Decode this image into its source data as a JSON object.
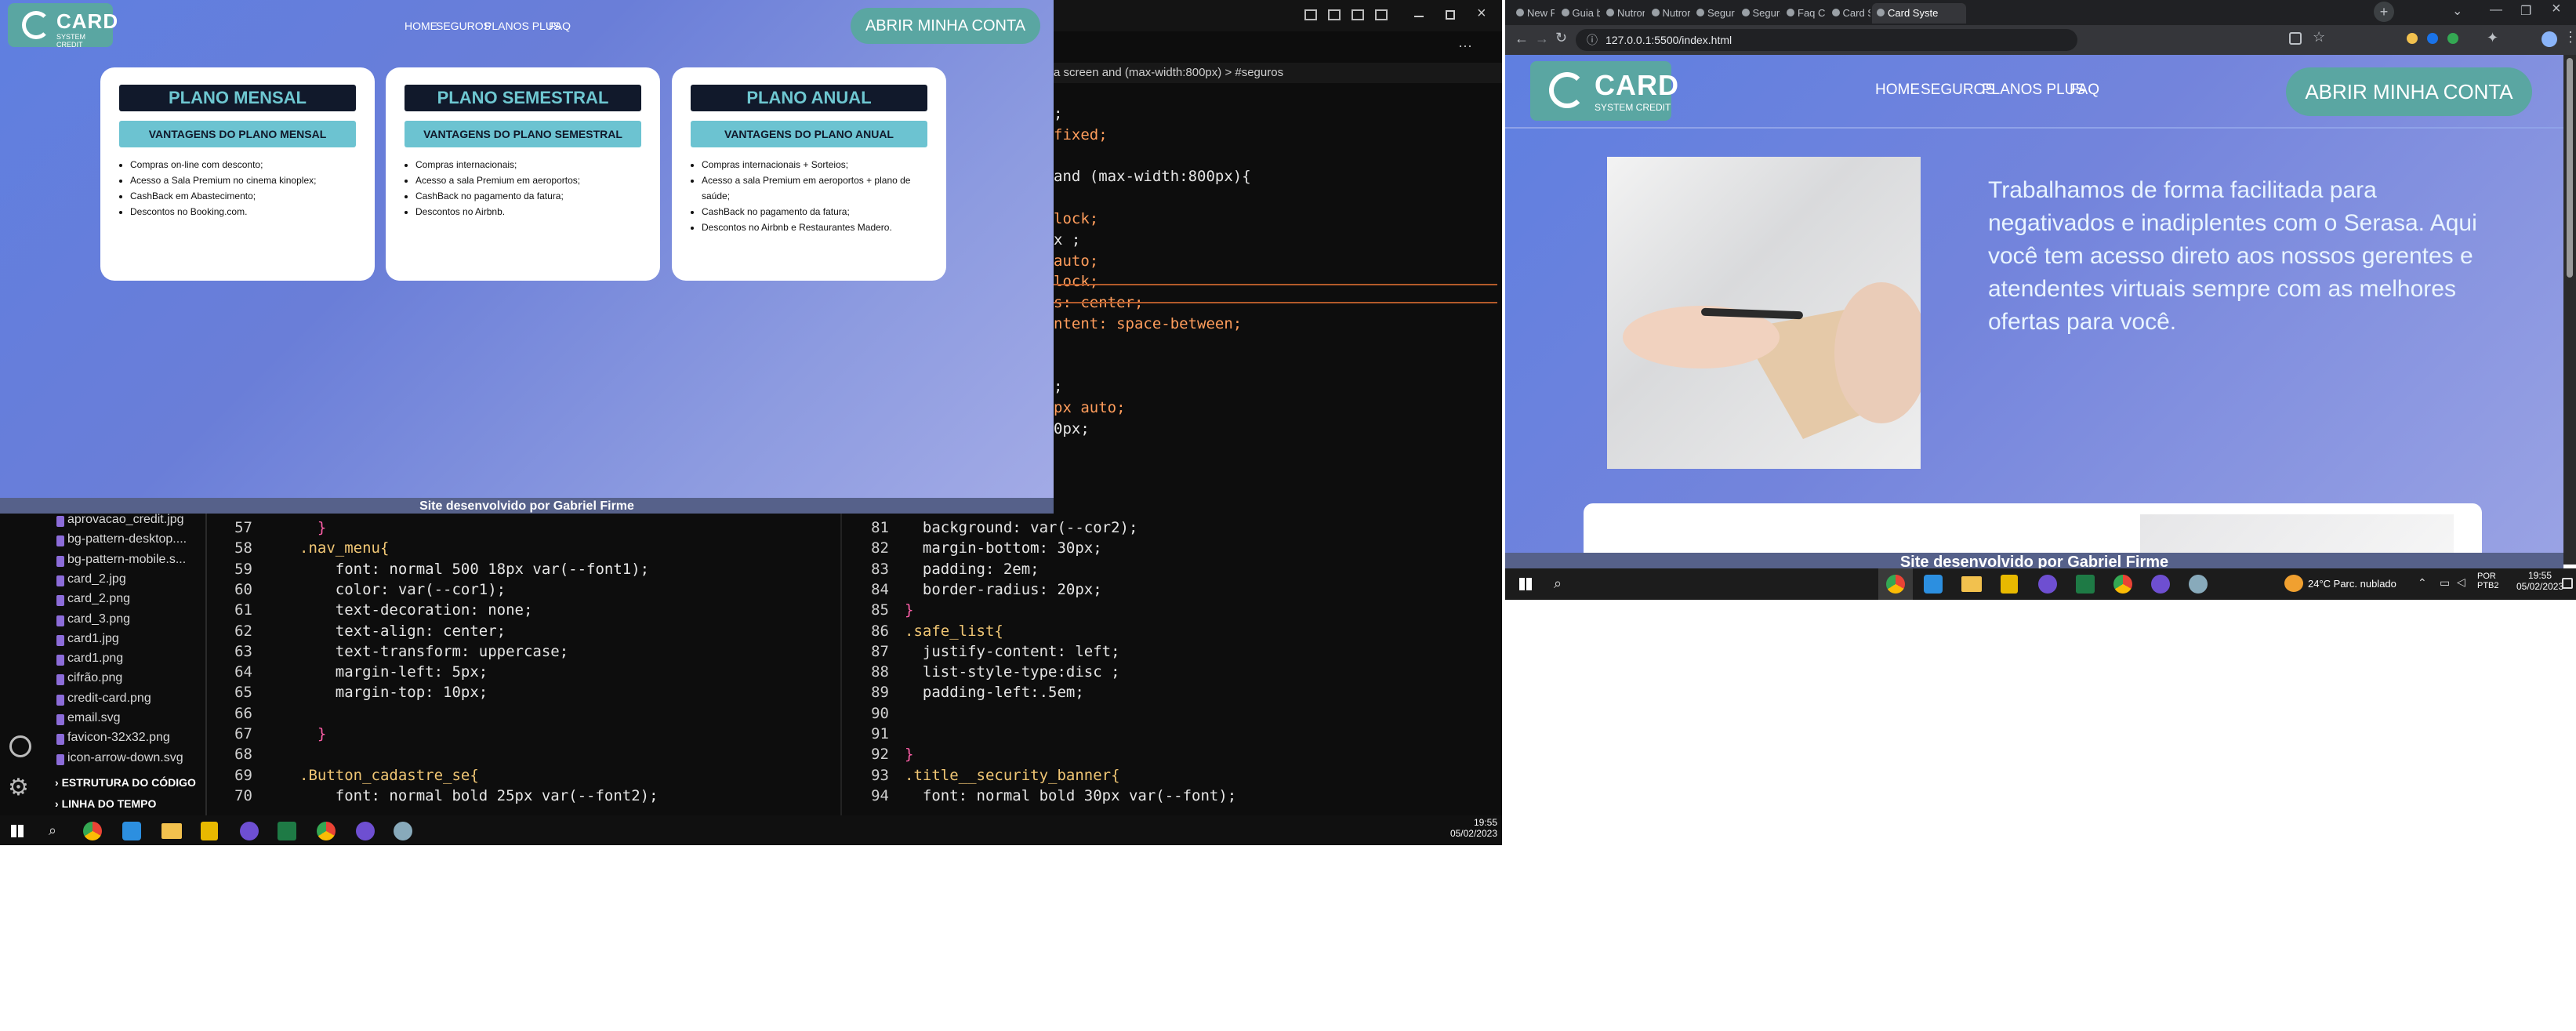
{
  "left_browser": {
    "logo": {
      "name": "CARD",
      "tagline": "SYSTEM CREDIT"
    },
    "nav": [
      "HOME",
      "SEGUROS",
      "PLANOS PLUS",
      "FAQ"
    ],
    "cta": "ABRIR MINHA CONTA",
    "plans": [
      {
        "title": "PLANO MENSAL",
        "button": "VANTAGENS DO PLANO MENSAL",
        "items": [
          "Compras on-line com desconto;",
          "Acesso a Sala Premium no cinema kinoplex;",
          "CashBack em Abastecimento;",
          "Descontos no Booking.com."
        ]
      },
      {
        "title": "PLANO SEMESTRAL",
        "button": "VANTAGENS DO PLANO SEMESTRAL",
        "items": [
          "Compras internacionais;",
          "Acesso a sala Premium em aeroportos;",
          "CashBack no pagamento da fatura;",
          "Descontos no Airbnb."
        ]
      },
      {
        "title": "PLANO ANUAL",
        "button": "VANTAGENS DO PLANO ANUAL",
        "items": [
          "Compras internacionais + Sorteios;",
          "Acesso a sala Premium em aeroportos + plano de saúde;",
          "CashBack no pagamento da fatura;",
          "Descontos no Airbnb e Restaurantes Madero."
        ]
      }
    ],
    "footer": "Site desenvolvido por Gabriel Firme"
  },
  "editor": {
    "file_tree": [
      "aprovacao_credit.jpg",
      "bg-pattern-desktop....",
      "bg-pattern-mobile.s...",
      "card_2.jpg",
      "card_2.png",
      "card_3.png",
      "card1.jpg",
      "card1.png",
      "cifrão.png",
      "credit-card.png",
      "email.svg",
      "favicon-32x32.png",
      "icon-arrow-down.svg"
    ],
    "sections": [
      "ESTRUTURA DO CÓDIGO",
      "LINHA DO TEMPO"
    ],
    "breadcrumb": "a screen and (max-width:800px) > #seguros",
    "left_pane": [
      {
        "n": "57",
        "code": "  }"
      },
      {
        "n": "58",
        "code": ".nav_menu{"
      },
      {
        "n": "59",
        "code": "    font: normal 500 18px var(--font1);"
      },
      {
        "n": "60",
        "code": "    color: var(--cor1);"
      },
      {
        "n": "61",
        "code": "    text-decoration: none;"
      },
      {
        "n": "62",
        "code": "    text-align: center;"
      },
      {
        "n": "63",
        "code": "    text-transform: uppercase;"
      },
      {
        "n": "64",
        "code": "    margin-left: 5px;"
      },
      {
        "n": "65",
        "code": "    margin-top: 10px;"
      },
      {
        "n": "66",
        "code": ""
      },
      {
        "n": "67",
        "code": "  }"
      },
      {
        "n": "68",
        "code": ""
      },
      {
        "n": "69",
        "code": ".Button_cadastre_se{"
      },
      {
        "n": "70",
        "code": "    font: normal bold 25px var(--font2);"
      }
    ],
    "right_pane_top": [
      ";",
      "fixed;",
      "",
      "and (max-width:800px){",
      "",
      "lock;",
      "x ;",
      "auto;",
      "lock;",
      "s: center;",
      "ntent: space-between;",
      "",
      "",
      ";",
      "px auto;",
      "0px;"
    ],
    "right_pane": [
      {
        "n": "81",
        "code": "  background: var(--cor2);"
      },
      {
        "n": "82",
        "code": "  margin-bottom: 30px;"
      },
      {
        "n": "83",
        "code": "  padding: 2em;"
      },
      {
        "n": "84",
        "code": "  border-radius: 20px;"
      },
      {
        "n": "85",
        "code": "}"
      },
      {
        "n": "86",
        "code": ".safe_list{"
      },
      {
        "n": "87",
        "code": "  justify-content: left;"
      },
      {
        "n": "88",
        "code": "  list-style-type:disc ;"
      },
      {
        "n": "89",
        "code": "  padding-left:.5em;"
      },
      {
        "n": "90",
        "code": ""
      },
      {
        "n": "91",
        "code": ""
      },
      {
        "n": "92",
        "code": "}"
      },
      {
        "n": "93",
        "code": ".title__security_banner{"
      },
      {
        "n": "94",
        "code": "  font: normal bold 30px var(--font);"
      }
    ],
    "clock": {
      "time": "19:55",
      "date": "05/02/2023"
    }
  },
  "right_browser": {
    "tabs": [
      "New File",
      "Guia básic",
      "Nutror.co",
      "Nutror - C",
      "Seguros |",
      "Seguros |",
      "Faq Card",
      "Card Syst",
      "Card Syste"
    ],
    "url": "127.0.0.1:5500/index.html",
    "logo": {
      "name": "CARD",
      "tagline": "SYSTEM CREDIT"
    },
    "nav": [
      "HOME",
      "SEGUROS",
      "PLANOS PLUS",
      "FAQ"
    ],
    "cta": "ABRIR MINHA CONTA",
    "hero_text": "Trabalhamos de forma facilitada para negativados e inadiplentes com o Serasa. Aqui você tem acesso direto aos nossos gerentes e atendentes virtuais sempre com as melhores ofertas para você.",
    "footer": "Site desenvolvido por Gabriel Firme",
    "taskbar": {
      "weather": "24°C Parc. nublado",
      "lang1": "POR",
      "lang2": "PTB2",
      "time": "19:55",
      "date": "05/02/2023"
    }
  },
  "colors": {
    "brand_teal": "#5aa6a2",
    "dark_navy": "#11192b",
    "light_cyan": "#6cc3d1"
  }
}
